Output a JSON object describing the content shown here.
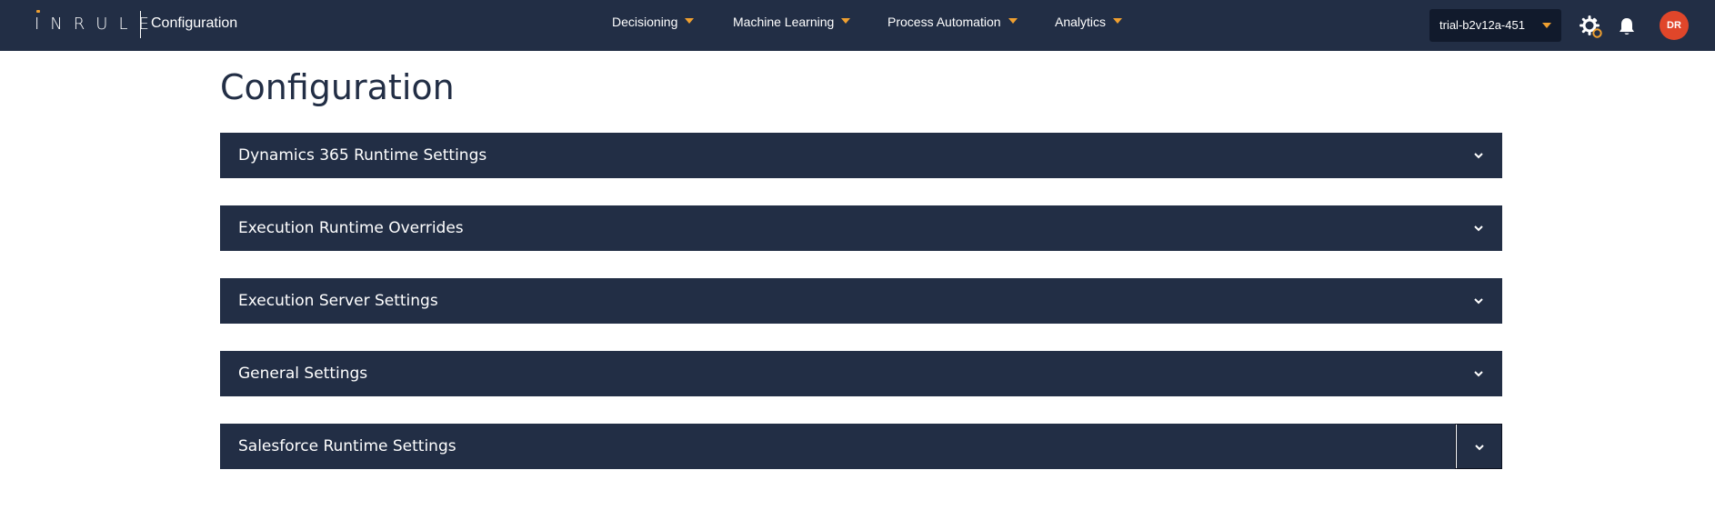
{
  "header": {
    "logo_text": "INRULE",
    "app_title": "Configuration",
    "nav": [
      {
        "label": "Decisioning"
      },
      {
        "label": "Machine Learning"
      },
      {
        "label": "Process Automation"
      },
      {
        "label": "Analytics"
      }
    ],
    "environment": "trial-b2v12a-451",
    "avatar_initials": "DR",
    "icons": [
      "gear-icon",
      "bell-icon",
      "chevron-down-icon"
    ],
    "colors": {
      "bar": "#222e45",
      "accent": "#f0a030",
      "avatar": "#e0462a"
    }
  },
  "page": {
    "title": "Configuration",
    "sections": [
      {
        "label": "Dynamics 365 Runtime Settings"
      },
      {
        "label": "Execution Runtime Overrides"
      },
      {
        "label": "Execution Server Settings"
      },
      {
        "label": "General Settings"
      },
      {
        "label": "Salesforce Runtime Settings"
      }
    ]
  }
}
